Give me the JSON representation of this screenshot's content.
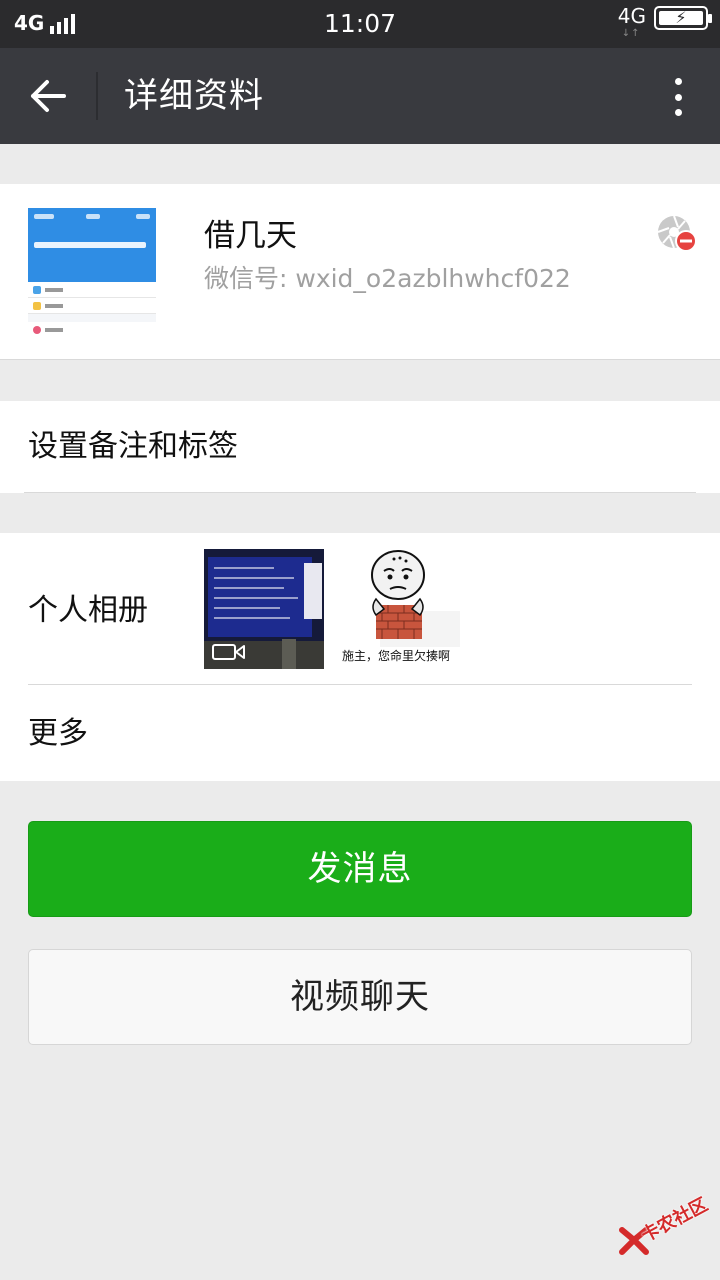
{
  "status_bar": {
    "network_left": "4G",
    "time": "11:07",
    "network_right": "4G",
    "arrows": "↓↑"
  },
  "nav": {
    "title": "详细资料"
  },
  "profile": {
    "name": "借几天",
    "wechat_id": "微信号: wxid_o2azblhwhcf022"
  },
  "remark": {
    "label": "设置备注和标签"
  },
  "album": {
    "label": "个人相册",
    "meme_caption": "施主，您命里欠揍啊"
  },
  "more": {
    "label": "更多"
  },
  "actions": {
    "send_message": "发消息",
    "video_chat": "视频聊天"
  },
  "watermark": {
    "text": "卡农社区"
  },
  "colors": {
    "primary_green": "#1aad19",
    "nav_bg": "#393a3f",
    "status_bg": "#2b2b2d",
    "page_bg": "#ebebeb"
  }
}
